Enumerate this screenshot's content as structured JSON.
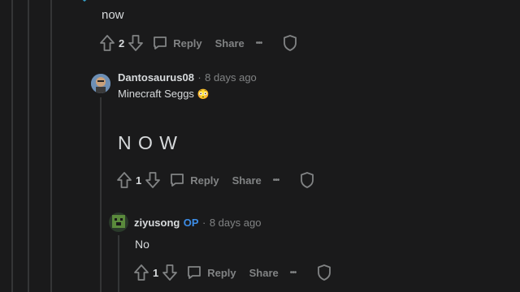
{
  "comments": [
    {
      "body": "now",
      "vote_count": "2",
      "reply_label": "Reply",
      "share_label": "Share",
      "more_label": "•••"
    },
    {
      "username": "Dantosaurus08",
      "separator": "·",
      "timestamp": "8 days ago",
      "body": "Minecraft Seggs",
      "emoji": "😳",
      "body2": "N O W",
      "vote_count": "1",
      "reply_label": "Reply",
      "share_label": "Share",
      "more_label": "•••"
    },
    {
      "username": "ziyusong",
      "op_badge": "OP",
      "separator": "·",
      "timestamp": "8 days ago",
      "body": "No",
      "vote_count": "1",
      "reply_label": "Reply",
      "share_label": "Share",
      "more_label": "•••"
    }
  ],
  "colors": {
    "background": "#1a1a1b",
    "text": "#d7dadc",
    "muted": "#818384",
    "op": "#3d8ee8"
  }
}
